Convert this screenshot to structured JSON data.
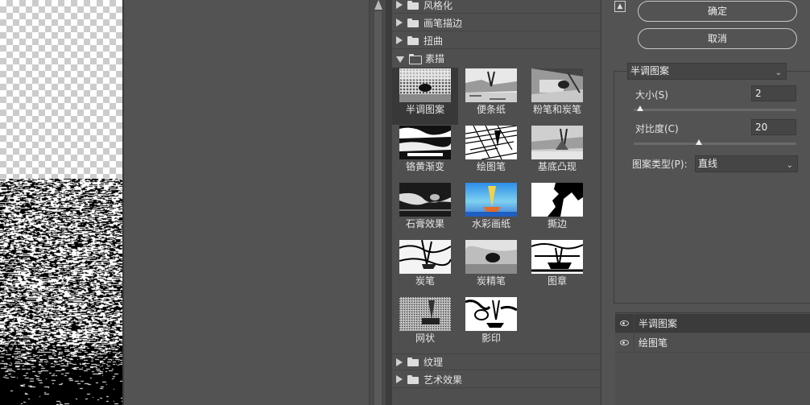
{
  "gallery": {
    "categories_top": [
      {
        "label": "风格化",
        "expanded": false
      },
      {
        "label": "画笔描边",
        "expanded": false
      },
      {
        "label": "扭曲",
        "expanded": false
      },
      {
        "label": "素描",
        "expanded": true
      }
    ],
    "sketch_filters": [
      {
        "label": "半调图案",
        "selected": true
      },
      {
        "label": "便条纸",
        "selected": false
      },
      {
        "label": "粉笔和炭笔",
        "selected": false
      },
      {
        "label": "铬黄渐变",
        "selected": false
      },
      {
        "label": "绘图笔",
        "selected": false
      },
      {
        "label": "基底凸现",
        "selected": false
      },
      {
        "label": "石膏效果",
        "selected": false
      },
      {
        "label": "水彩画纸",
        "selected": false
      },
      {
        "label": "撕边",
        "selected": false
      },
      {
        "label": "炭笔",
        "selected": false
      },
      {
        "label": "炭精笔",
        "selected": false
      },
      {
        "label": "图章",
        "selected": false
      },
      {
        "label": "网状",
        "selected": false
      },
      {
        "label": "影印",
        "selected": false
      }
    ],
    "categories_bottom": [
      {
        "label": "纹理",
        "expanded": false
      },
      {
        "label": "艺术效果",
        "expanded": false
      }
    ]
  },
  "actions": {
    "ok_label": "确定",
    "cancel_label": "取消"
  },
  "settings": {
    "filter_select": "半调图案",
    "size_label": "大小(S)",
    "size_value": "2",
    "size_slider_fraction": 0.04,
    "contrast_label": "对比度(C)",
    "contrast_value": "20",
    "contrast_slider_fraction": 0.4,
    "pattern_type_label": "图案类型(P):",
    "pattern_type_value": "直线"
  },
  "layers": [
    {
      "name": "半调图案",
      "visible": true,
      "selected": true
    },
    {
      "name": "绘图笔",
      "visible": true,
      "selected": false
    }
  ],
  "icons": {
    "collapse": "collapse-panel-icon",
    "eye": "eye-icon",
    "folder": "folder-icon"
  }
}
